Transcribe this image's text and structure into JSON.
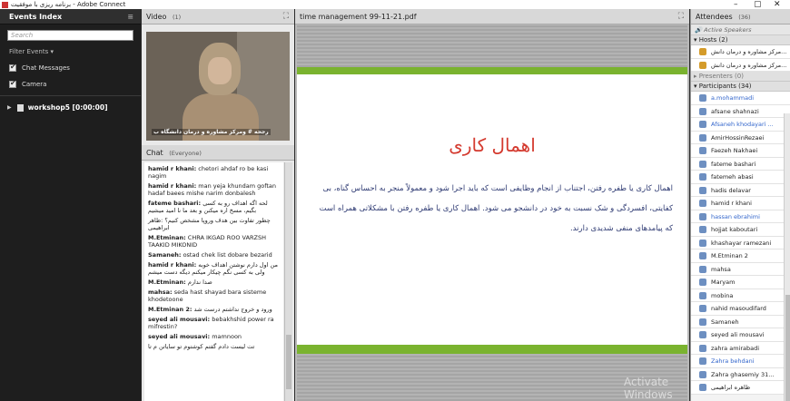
{
  "window": {
    "title": "برنامه ریزی با موفقیت - Adobe Connect",
    "controls": [
      "–",
      "▢",
      "✕"
    ]
  },
  "events": {
    "header": "Events Index",
    "search_placeholder": "Search",
    "filter_label": "Filter Events ▾",
    "checkboxes": [
      "Chat Messages",
      "Camera"
    ],
    "item": "workshop5 [0:00:00]"
  },
  "video": {
    "title": "Video",
    "count": "(1)",
    "caption": "رجحه # ومرکز مشاوره و درمان دانشگاه ب"
  },
  "chat": {
    "title": "Chat",
    "scope": "(Everyone)",
    "messages": [
      {
        "name": "hamid r khani:",
        "text": " chetori ahdaf ro be kasi nagim"
      },
      {
        "name": "hamid r khani:",
        "text": " man yeja khundam goftan hadaf baees mishe narim donbalesh"
      },
      {
        "name": "fateme bashari:",
        "text": " لحه اگه اهداف رو به کسی بگیم، مسخ اره میکنن و بعد ما نا امید میشیم"
      },
      {
        "name": "",
        "text": "چطور تفاوت بین هدف وروپا مشخص کنیم؟ :ظاهر ابراهیمی"
      },
      {
        "name": "M.Etminan:",
        "text": " CHRA IKGAD ROO VARZSH TAAKID MIKONID"
      },
      {
        "name": "Samaneh:",
        "text": " ostad chek list dobare bezarid"
      },
      {
        "name": "hamid r khani:",
        "text": " من اول دارم نوشتن اهداف خوبه ولی به کسی نگم چیکار میکنم دیگه دست میشم"
      },
      {
        "name": "M.Etminan:",
        "text": " صدا ندارم"
      },
      {
        "name": "mahsa:",
        "text": " seda hast shayad bara sisteme khodetoone"
      },
      {
        "name": "M.Etminan 2:",
        "text": " ورود و خروج نداشتم درست شد"
      },
      {
        "name": "seyed ali mousavi:",
        "text": " bebakhshid power ra mifrestin?"
      },
      {
        "name": "seyed ali mousavi:",
        "text": " mamnoon"
      },
      {
        "name": "",
        "text": "تت لیست دادم گفتم کوشتوم تو سایاتن م تا"
      }
    ]
  },
  "presentation": {
    "file_title": "time management  99-11-21.pdf",
    "slide_title": "اهمال کاری",
    "slide_body": "اهمال کاری یا طفره رفتن، اجتناب از انجام وظایفی است که باید اجرا شود و معمولاً منجر به احساس گناه، بی کفایتی، افسردگی و شک نسبت به خود در دانشجو می شود. اهمال کاری یا طفره رفتن با مشکلاتی همراه است که پیامدهای منفی شدیدی دارند.",
    "watermark": "Activate Windows"
  },
  "attendees": {
    "title": "Attendees",
    "count": "(36)",
    "active_speakers": "Active Speakers",
    "hosts_label": "▾ Hosts (2)",
    "hosts": [
      "مرکز مشاوره و درمان دانش...",
      "مرکز مشاوره و درمان دانش..."
    ],
    "presenters_label": "▸ Presenters (0)",
    "participants_label": "▾ Participants (34)",
    "participants": [
      {
        "name": "a.mohammadi",
        "blue": true
      },
      {
        "name": "afsane shahnazi",
        "blue": false
      },
      {
        "name": "Afsaneh khodayari ...",
        "blue": true
      },
      {
        "name": "AmirHossinRezaei",
        "blue": false
      },
      {
        "name": "Faezeh Nakhaei",
        "blue": false
      },
      {
        "name": "fateme bashari",
        "blue": false
      },
      {
        "name": "fatemeh abasi",
        "blue": false
      },
      {
        "name": "hadis delavar",
        "blue": false
      },
      {
        "name": "hamid r khani",
        "blue": false
      },
      {
        "name": "hassan ebrahimi",
        "blue": true
      },
      {
        "name": "hojjat kaboutari",
        "blue": false
      },
      {
        "name": "khashayar ramezani",
        "blue": false
      },
      {
        "name": "M.Etminan 2",
        "blue": false
      },
      {
        "name": "mahsa",
        "blue": false
      },
      {
        "name": "Maryam",
        "blue": false
      },
      {
        "name": "mobina",
        "blue": false
      },
      {
        "name": "nahid masoudifard",
        "blue": false
      },
      {
        "name": "Samaneh",
        "blue": false
      },
      {
        "name": "seyed ali mousavi",
        "blue": false
      },
      {
        "name": "zahra amirabadi",
        "blue": false
      },
      {
        "name": "Zahra behdani",
        "blue": true
      },
      {
        "name": "Zahra ghasemiy 31...",
        "blue": false
      },
      {
        "name": "ظاهره ابراهیمی",
        "blue": false
      }
    ]
  }
}
